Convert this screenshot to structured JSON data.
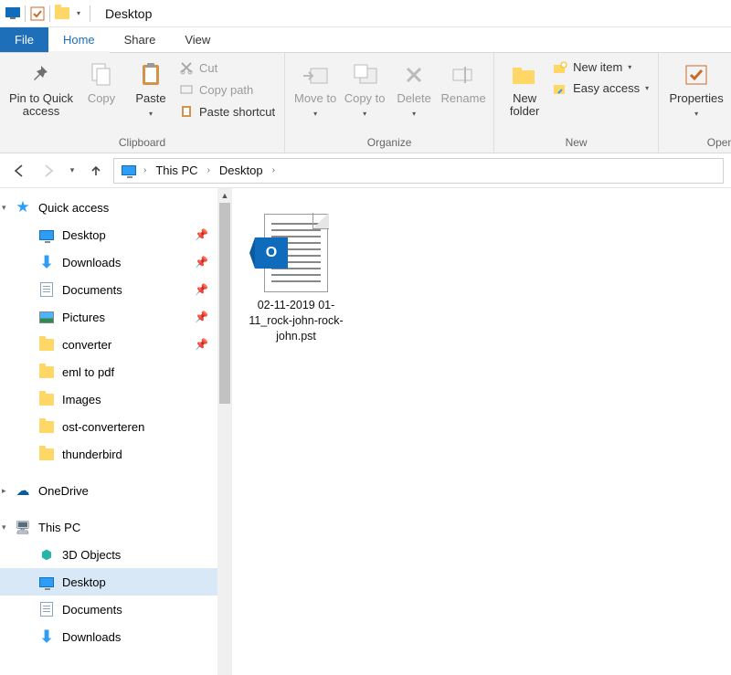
{
  "titlebar": {
    "title": "Desktop"
  },
  "tabs": {
    "file": "File",
    "home": "Home",
    "share": "Share",
    "view": "View"
  },
  "ribbon": {
    "clipboard": {
      "label": "Clipboard",
      "pin": "Pin to Quick access",
      "copy": "Copy",
      "paste": "Paste",
      "cut": "Cut",
      "copy_path": "Copy path",
      "paste_shortcut": "Paste shortcut"
    },
    "organize": {
      "label": "Organize",
      "move_to": "Move to",
      "copy_to": "Copy to",
      "delete": "Delete",
      "rename": "Rename"
    },
    "new": {
      "label": "New",
      "new_folder": "New folder",
      "new_item": "New item",
      "easy_access": "Easy access"
    },
    "open": {
      "label": "Open",
      "properties": "Properties"
    }
  },
  "breadcrumb": {
    "level1": "This PC",
    "level2": "Desktop"
  },
  "tree": {
    "quick_access": "Quick access",
    "desktop": "Desktop",
    "downloads": "Downloads",
    "documents": "Documents",
    "pictures": "Pictures",
    "converter": "converter",
    "eml_to_pdf": "eml to pdf",
    "images": "Images",
    "ost_converteren": "ost-converteren",
    "thunderbird": "thunderbird",
    "onedrive": "OneDrive",
    "this_pc": "This PC",
    "objects3d": "3D Objects",
    "desktop2": "Desktop",
    "documents2": "Documents",
    "downloads2": "Downloads"
  },
  "files": [
    {
      "name": "02-11-2019 01-11_rock-john-rock-john.pst",
      "icon_letter": "O"
    }
  ]
}
